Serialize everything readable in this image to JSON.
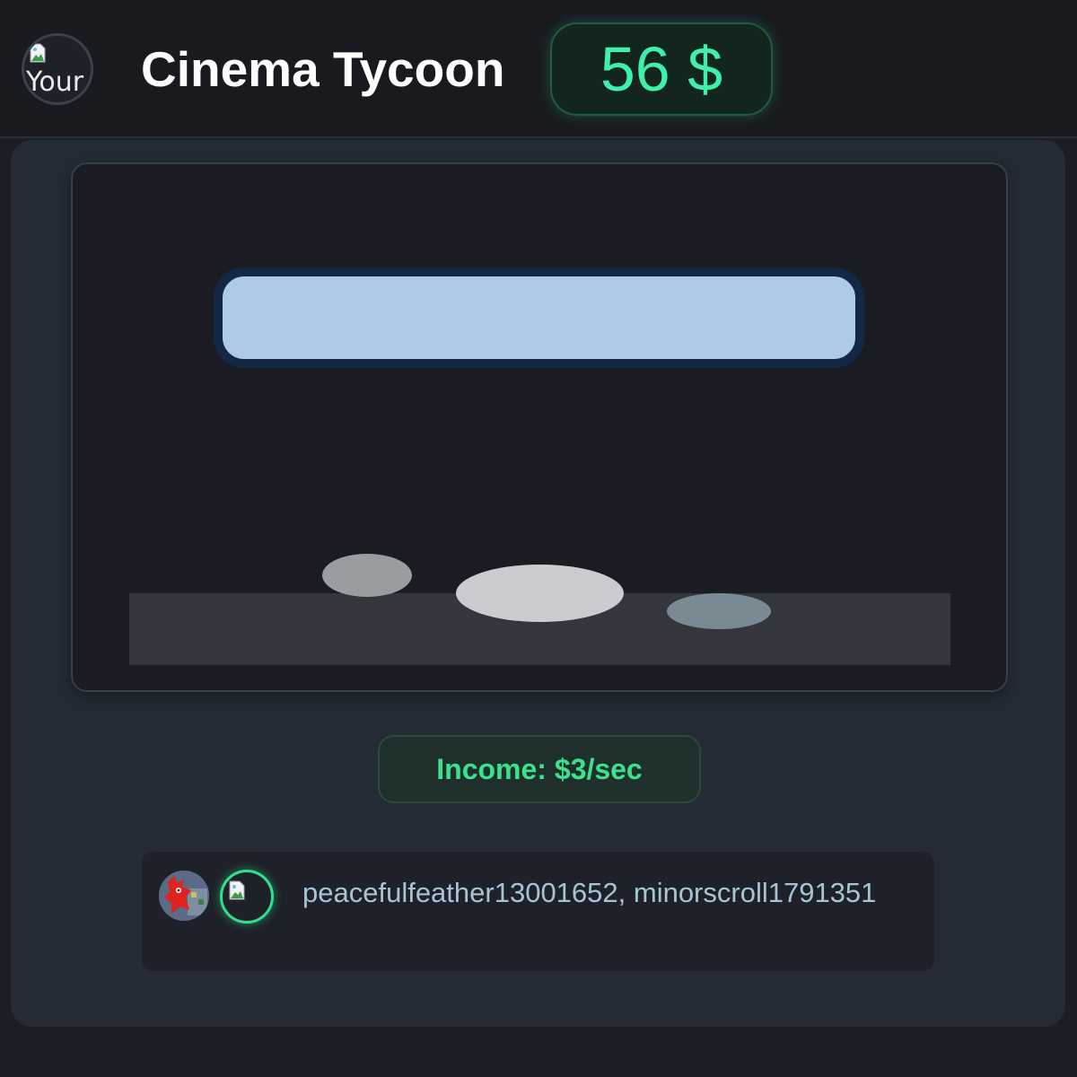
{
  "header": {
    "avatar_alt": "Your",
    "title": "Cinema Tycoon",
    "balance": "56 $"
  },
  "theater": {
    "screen_color": "#afc9e8",
    "audience_heads": 3
  },
  "income": {
    "label": "Income: $3/sec"
  },
  "players": {
    "names": "peacefulfeather13001652, minorscroll1791351",
    "avatars": [
      "red-character-avatar",
      "broken-image-avatar"
    ]
  },
  "colors": {
    "accent_green": "#3ff0ad",
    "income_green": "#3ce18e",
    "background": "#1b1e25",
    "panel": "#252b35"
  }
}
